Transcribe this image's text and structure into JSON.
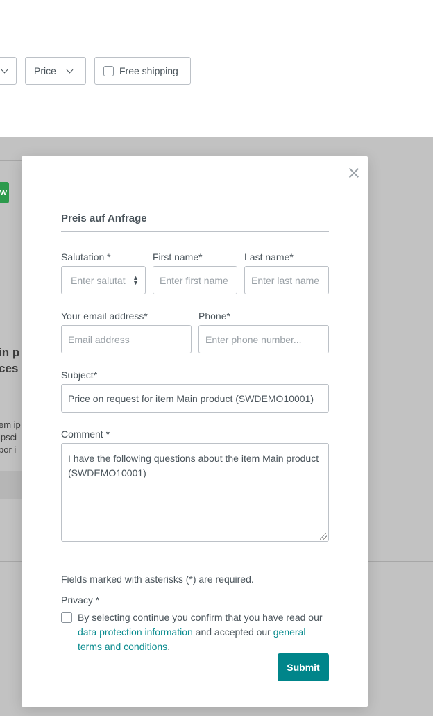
{
  "filters": {
    "price_label": "Price",
    "free_shipping_label": "Free shipping"
  },
  "background": {
    "badge": "w",
    "heading_lines": [
      "in p",
      "ces"
    ],
    "text_lines": [
      "em ip",
      "ipsci",
      "por i"
    ]
  },
  "modal": {
    "title": "Preis auf Anfrage",
    "salutation": {
      "label": "Salutation *",
      "placeholder": "Enter salutat"
    },
    "first_name": {
      "label": "First name*",
      "placeholder": "Enter first name"
    },
    "last_name": {
      "label": "Last name*",
      "placeholder": "Enter last name"
    },
    "email": {
      "label": "Your email address*",
      "placeholder": "Email address"
    },
    "phone": {
      "label": "Phone*",
      "placeholder": "Enter phone number..."
    },
    "subject": {
      "label": "Subject*",
      "value": "Price on request for item Main product (SWDEMO10001)"
    },
    "comment": {
      "label": "Comment *",
      "value": "I have the following questions about the item Main product (SWDEMO10001)"
    },
    "required_note": "Fields marked with asterisks (*) are required.",
    "privacy": {
      "label": "Privacy *",
      "text_before": "By selecting continue you confirm that you have read our ",
      "link1": "data protection information",
      "text_middle": " and accepted our ",
      "link2": "general terms and conditions",
      "text_after": "."
    },
    "submit_label": "Submit"
  },
  "colors": {
    "accent": "#00858a",
    "link": "#0b8c8f",
    "badge": "#2ea44f"
  }
}
